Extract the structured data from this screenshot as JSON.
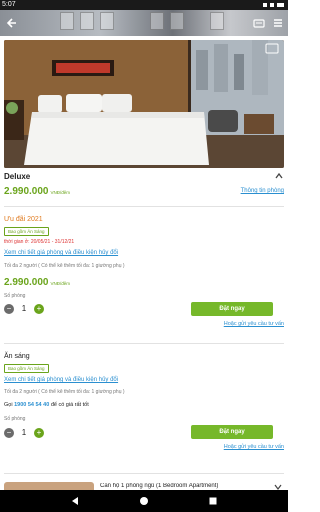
{
  "status_bar": {
    "time": "5:07"
  },
  "room": {
    "name": "Deluxe",
    "price": "2.990.000",
    "price_unit": "VNĐ/đêm",
    "info_link": "Thông tin phòng"
  },
  "offers": [
    {
      "title": "Ưu đãi 2021",
      "badge": "Bao gồm Ăn Sáng",
      "period": "thời gian ở: 20/05/21 - 31/12/21",
      "detail_link": "Xem chi tiết giá phòng và điều kiện hủy đổi",
      "capacity": "Tối đa 2 người ( Có thể kê thêm tối đa: 1 giường phụ )",
      "price": "2.990.000",
      "price_unit": "VNĐ/đêm",
      "rooms_label": "Số phòng",
      "quantity": "1",
      "book_label": "Đặt ngay",
      "consult_link": "Hoặc gửi yêu cầu tư vấn"
    },
    {
      "title": "Ăn sáng",
      "badge": "Bao gồm Ăn Sáng",
      "detail_link": "Xem chi tiết giá phòng và điều kiện hủy đổi",
      "capacity": "Tối đa 2 người ( Có thể kê thêm tối đa: 1 giường phụ )",
      "hotline_prefix": "Gọi",
      "hotline_number": "1900 54 54 40",
      "hotline_suffix": "để có giá rất tốt",
      "rooms_label": "Số phòng",
      "quantity": "1",
      "book_label": "Đặt ngay",
      "consult_link": "Hoặc gửi yêu cầu tư vấn"
    }
  ],
  "next_room_title": "Căn hộ 1 phòng ngủ (1 Bedroom Apartment)",
  "colors": {
    "accent_green": "#76b82a",
    "price_green": "#6aa41b",
    "link_blue": "#2a8fd0",
    "offer_orange": "#e07a1f",
    "period_red": "#d33333"
  },
  "icons": [
    "back-arrow-icon",
    "cart-icon",
    "menu-icon",
    "gallery-icon",
    "chevron-up-icon",
    "chevron-down-icon",
    "minus-icon",
    "plus-icon",
    "nav-back-icon",
    "nav-home-icon",
    "nav-recent-icon"
  ]
}
